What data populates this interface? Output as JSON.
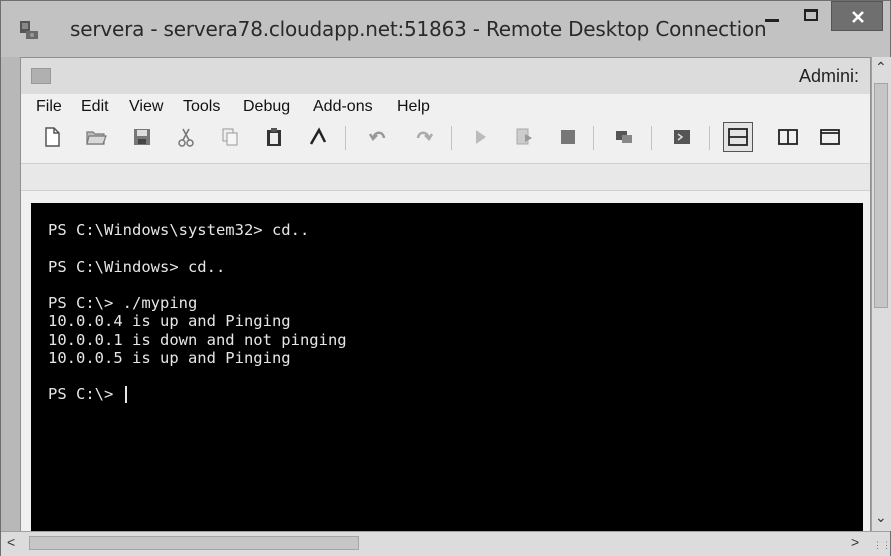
{
  "window": {
    "title": "servera - servera78.cloudapp.net:51863 - Remote Desktop Connection"
  },
  "ise": {
    "title_partial": "Admini:"
  },
  "menu": [
    "File",
    "Edit",
    "View",
    "Tools",
    "Debug",
    "Add-ons",
    "Help"
  ],
  "console": {
    "lines": [
      "PS C:\\Windows\\system32> cd..",
      "PS C:\\Windows> cd..",
      "PS C:\\> ./myping",
      "10.0.0.4 is up and Pinging",
      "10.0.0.1 is down and not pinging",
      "10.0.0.5 is up and Pinging",
      "PS C:\\> "
    ]
  },
  "toolbar_icons": [
    "new-file-icon",
    "open-folder-icon",
    "save-icon",
    "cut-icon",
    "copy-icon",
    "paste-icon",
    "clear-icon",
    "undo-icon",
    "redo-icon",
    "run-icon",
    "run-selection-icon",
    "stop-icon",
    "remote-powershell-icon",
    "powershell-icon",
    "layout-top-icon",
    "layout-right-icon",
    "layout-max-icon"
  ]
}
